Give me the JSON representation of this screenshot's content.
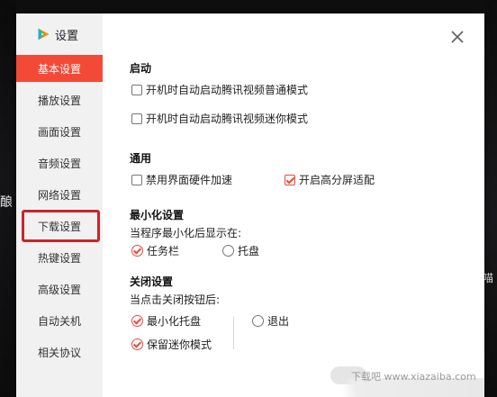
{
  "background": {
    "left_text": "酿",
    "right_text": "喵"
  },
  "dialog": {
    "title": "设置",
    "close_icon": "close-icon",
    "accent_color": "#f34a38"
  },
  "sidebar": {
    "items": [
      {
        "label": "基本设置",
        "active": true
      },
      {
        "label": "播放设置",
        "active": false
      },
      {
        "label": "画面设置",
        "active": false
      },
      {
        "label": "音频设置",
        "active": false
      },
      {
        "label": "网络设置",
        "active": false
      },
      {
        "label": "下载设置",
        "active": false,
        "highlighted": true
      },
      {
        "label": "热键设置",
        "active": false
      },
      {
        "label": "高级设置",
        "active": false
      },
      {
        "label": "自动关机",
        "active": false
      },
      {
        "label": "相关协议",
        "active": false
      }
    ]
  },
  "content": {
    "startup": {
      "title": "启动",
      "options": [
        {
          "label": "开机时自动启动腾讯视频普通模式",
          "checked": false
        },
        {
          "label": "开机时自动启动腾讯视频迷你模式",
          "checked": false
        }
      ]
    },
    "general": {
      "title": "通用",
      "options": [
        {
          "label": "禁用界面硬件加速",
          "checked": false
        },
        {
          "label": "开启高分屏适配",
          "checked": true
        }
      ]
    },
    "minimize": {
      "title": "最小化设置",
      "prompt": "当程序最小化后显示在:",
      "options": [
        {
          "label": "任务栏",
          "checked": true
        },
        {
          "label": "托盘",
          "checked": false
        }
      ]
    },
    "close": {
      "title": "关闭设置",
      "prompt": "当点击关闭按钮后:",
      "options": [
        {
          "label": "最小化托盘",
          "checked": true
        },
        {
          "label": "保留迷你模式",
          "checked": true
        },
        {
          "label": "退出",
          "checked": false
        }
      ]
    }
  },
  "watermark": "下载吧 www.xiazaiba.com"
}
